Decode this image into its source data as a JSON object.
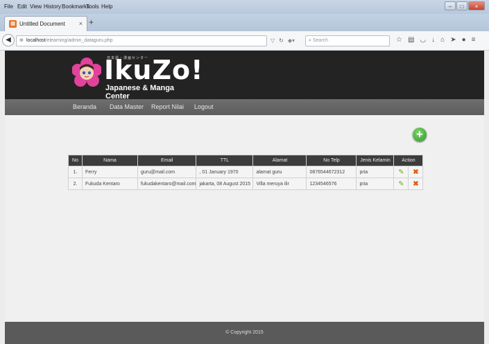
{
  "browser": {
    "menu": [
      "File",
      "Edit",
      "View",
      "History",
      "Bookmarks",
      "Tools",
      "Help"
    ],
    "tab_title": "Untitled Document",
    "tab_close": "×",
    "new_tab": "+",
    "url_host": "localhost",
    "url_path": "/elearning/admin_dataguru.php",
    "search_placeholder": "Search",
    "window_controls": [
      "–",
      "□",
      "×"
    ]
  },
  "site": {
    "logo_jp": "日本語・漫画センター",
    "logo_title": "IkuZo",
    "logo_exclaim": "!",
    "logo_subtitle": "Japanese & Manga Center"
  },
  "nav": {
    "items": [
      "Beranda",
      "Data Master",
      "Report Nilai",
      "Logout"
    ]
  },
  "table": {
    "headers": [
      "No",
      "Nama",
      "Email",
      "TTL",
      "Alamat",
      "No Telp",
      "Jenis Kelamin",
      "Action"
    ],
    "rows": [
      [
        "1.",
        "Ferry",
        "guru@mail.com",
        ", 01 January 1970",
        "alamat guru",
        "0876544672312",
        "pria"
      ],
      [
        "2.",
        "Fukuda Kentaro",
        "fukudakentaro@mail.com",
        "jakarta, 08 August 2015",
        "Villa meruya ilir",
        "1234546576",
        "pria"
      ]
    ],
    "edit_icon": "✎",
    "delete_icon": "✖",
    "add_icon": "+"
  },
  "footer": {
    "copyright": "© Copyright 2015"
  },
  "colors": {
    "header_bg": "#232323",
    "nav_bg": "#666666",
    "add_button": "#3aa33a",
    "edit_icon": "#7da21f",
    "delete_icon": "#e25a14"
  }
}
